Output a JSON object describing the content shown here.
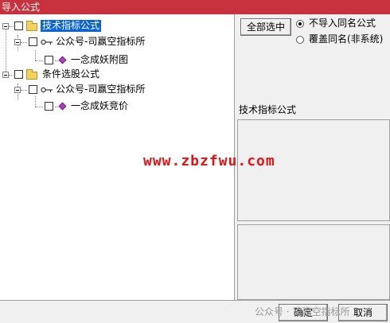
{
  "window": {
    "title": "导入公式"
  },
  "tree": {
    "nodes": [
      {
        "label": "技术指标公式",
        "level": 0,
        "selected": true
      },
      {
        "label": "公众号-司赢空指标所",
        "level": 1
      },
      {
        "label": "一念成妖附图",
        "level": 2
      },
      {
        "label": "条件选股公式",
        "level": 0
      },
      {
        "label": "公众号-司赢空指标所",
        "level": 1
      },
      {
        "label": "一念成妖竞价",
        "level": 2
      }
    ]
  },
  "right": {
    "select_all_button": "全部选中",
    "options": [
      {
        "label": "不导入同名公式",
        "checked": true
      },
      {
        "label": "覆盖同名(非系统)",
        "checked": false
      }
    ],
    "info_title": "技术指标公式"
  },
  "buttons": {
    "ok": "确定",
    "cancel": "取消"
  },
  "overlays": {
    "watermark_url": "www.zbzfwu.com",
    "watermark_account": "公众号 · 司赢空指标所"
  },
  "colors": {
    "titlebar": "#c8313e",
    "selection": "#0a64d6",
    "watermark": "#e11414"
  }
}
